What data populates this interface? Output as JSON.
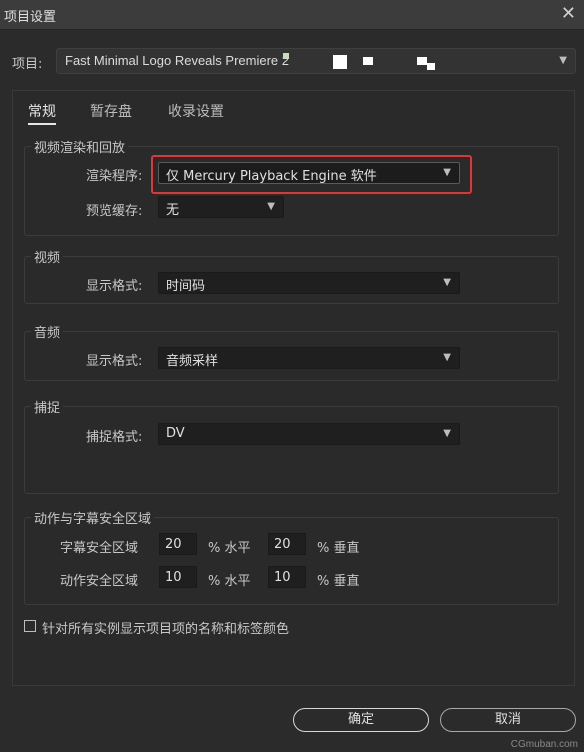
{
  "window": {
    "title": "项目设置",
    "close_icon": "close-icon"
  },
  "project": {
    "label": "项目:",
    "value": "Fast Minimal Logo Reveals Premiere 2"
  },
  "tabs": [
    {
      "label": "常规",
      "active": true
    },
    {
      "label": "暂存盘",
      "active": false
    },
    {
      "label": "收录设置",
      "active": false
    }
  ],
  "video_render": {
    "title": "视频渲染和回放",
    "renderer_label": "渲染程序:",
    "renderer_value": "仅 Mercury Playback Engine 软件",
    "preview_cache_label": "预览缓存:",
    "preview_cache_value": "无"
  },
  "video": {
    "title": "视频",
    "display_format_label": "显示格式:",
    "display_format_value": "时间码"
  },
  "audio": {
    "title": "音频",
    "display_format_label": "显示格式:",
    "display_format_value": "音频采样"
  },
  "capture": {
    "title": "捕捉",
    "capture_format_label": "捕捉格式:",
    "capture_format_value": "DV"
  },
  "safe_zones": {
    "title": "动作与字幕安全区域",
    "title_safe_label": "字幕安全区域",
    "title_safe_h": "20",
    "title_safe_h_unit": "% 水平",
    "title_safe_v": "20",
    "title_safe_v_unit": "% 垂直",
    "action_safe_label": "动作安全区域",
    "action_safe_h": "10",
    "action_safe_h_unit": "% 水平",
    "action_safe_v": "10",
    "action_safe_v_unit": "% 垂直"
  },
  "checkbox": {
    "label": "针对所有实例显示项目项的名称和标签颜色",
    "checked": false
  },
  "buttons": {
    "ok": "确定",
    "cancel": "取消"
  },
  "watermark": "CGmuban.com",
  "colors": {
    "highlight": "#e23535",
    "background": "#2b2b2b"
  }
}
